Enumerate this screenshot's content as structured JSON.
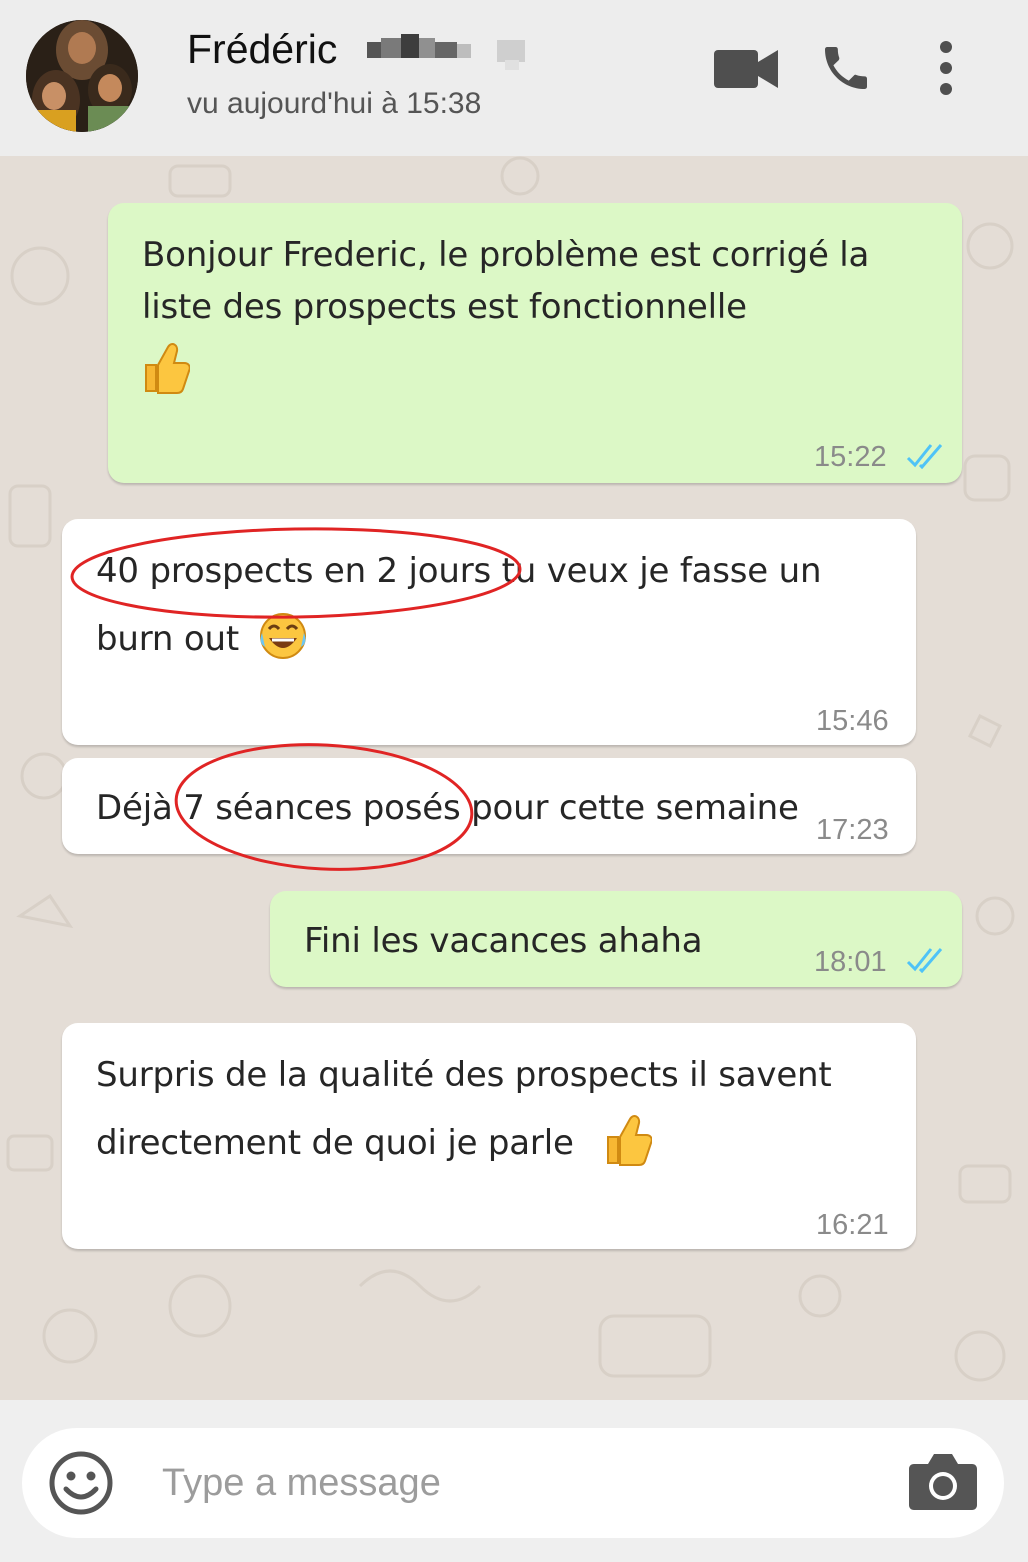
{
  "header": {
    "contact_name": "Frédéric",
    "last_seen": "vu aujourd'hui à 15:38",
    "icons": {
      "video": "video-camera-icon",
      "call": "phone-icon",
      "menu": "more-vertical-icon"
    }
  },
  "messages": [
    {
      "direction": "outgoing",
      "lines": [
        "Bonjour Frederic, le problème est corrigé la",
        "liste des prospects est fonctionnelle"
      ],
      "emoji": "thumbs-up",
      "time": "15:22",
      "status": "read"
    },
    {
      "direction": "incoming",
      "lines": [
        "40 prospects en 2 jours tu veux je fasse un",
        "burn out"
      ],
      "emoji": "face-with-tears-of-joy",
      "time": "15:46",
      "highlight": "40 prospects en 2 jours"
    },
    {
      "direction": "incoming",
      "lines": [
        "Déjà 7 séances posés pour cette semaine"
      ],
      "time": "17:23",
      "highlight": "7 séances posés"
    },
    {
      "direction": "outgoing",
      "lines": [
        "Fini les vacances ahaha"
      ],
      "time": "18:01",
      "status": "read"
    },
    {
      "direction": "incoming",
      "lines": [
        "Surpris de la qualité des prospects il savent",
        "directement de quoi je parle"
      ],
      "emoji": "thumbs-up",
      "time": "16:21"
    }
  ],
  "composer": {
    "placeholder": "Type a message",
    "value": "",
    "icons": {
      "emoji": "smiley-icon",
      "camera": "camera-icon"
    }
  },
  "colors": {
    "header_bg": "#ededed",
    "chat_bg": "#e4ddd6",
    "outgoing_bubble": "#dcf8c6",
    "incoming_bubble": "#ffffff",
    "read_ticks": "#4fc3f7",
    "annotation": "#e02424",
    "icon_gray": "#4f4f4f"
  }
}
